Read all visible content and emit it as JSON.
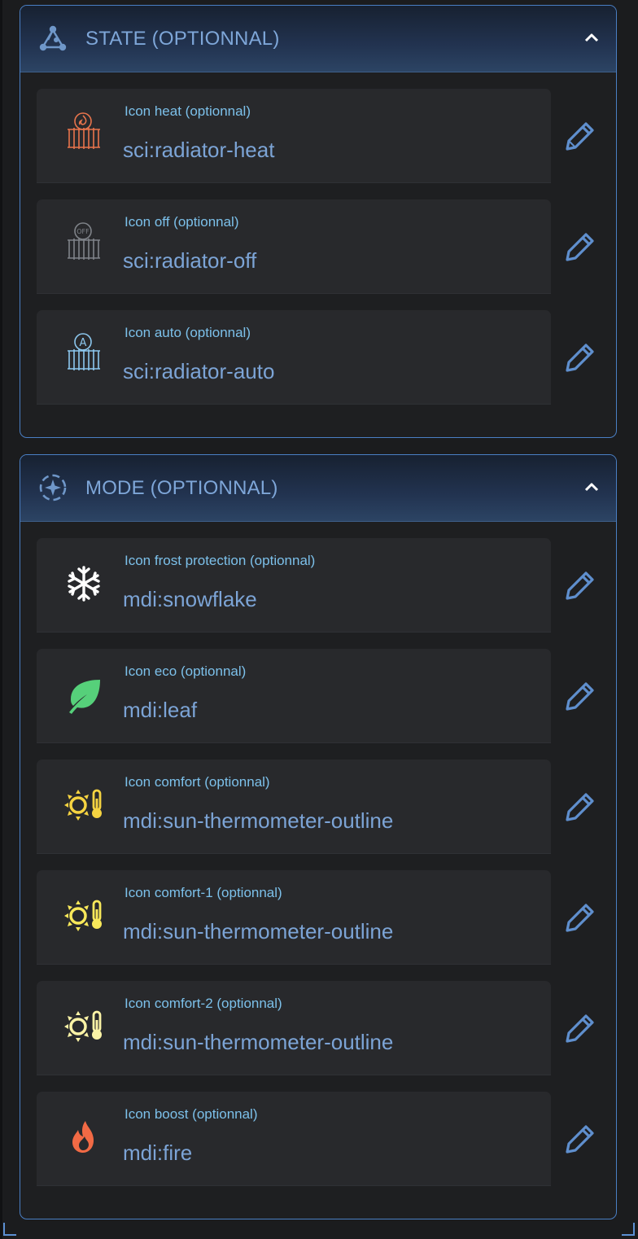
{
  "colors": {
    "accent": "#4a7fc4",
    "label": "#7cc0ea",
    "value": "#7ca4d6",
    "field_bg": "#28292c",
    "panel_bg": "#1e1f21"
  },
  "sections": [
    {
      "title": "STATE (OPTIONNAL)",
      "icon": "state-graph-icon",
      "collapse_icon": "chevron-up-icon",
      "fields": [
        {
          "label": "Icon heat (optionnal)",
          "value": "sci:radiator-heat",
          "icon": "radiator-heat-icon",
          "edit_icon": "pencil-icon"
        },
        {
          "label": "Icon off (optionnal)",
          "value": "sci:radiator-off",
          "icon": "radiator-off-icon",
          "edit_icon": "pencil-icon"
        },
        {
          "label": "Icon auto (optionnal)",
          "value": "sci:radiator-auto",
          "icon": "radiator-auto-icon",
          "edit_icon": "pencil-icon"
        }
      ]
    },
    {
      "title": "MODE (OPTIONNAL)",
      "icon": "mode-sparkle-icon",
      "collapse_icon": "chevron-up-icon",
      "fields": [
        {
          "label": "Icon frost protection (optionnal)",
          "value": "mdi:snowflake",
          "icon": "snowflake-icon",
          "edit_icon": "pencil-icon"
        },
        {
          "label": "Icon eco (optionnal)",
          "value": "mdi:leaf",
          "icon": "leaf-icon",
          "edit_icon": "pencil-icon"
        },
        {
          "label": "Icon comfort (optionnal)",
          "value": "mdi:sun-thermometer-outline",
          "icon": "sun-thermometer-icon",
          "edit_icon": "pencil-icon"
        },
        {
          "label": "Icon comfort-1 (optionnal)",
          "value": "mdi:sun-thermometer-outline",
          "icon": "sun-thermometer-icon",
          "edit_icon": "pencil-icon"
        },
        {
          "label": "Icon comfort-2 (optionnal)",
          "value": "mdi:sun-thermometer-outline",
          "icon": "sun-thermometer-icon",
          "edit_icon": "pencil-icon"
        },
        {
          "label": "Icon boost (optionnal)",
          "value": "mdi:fire",
          "icon": "fire-icon",
          "edit_icon": "pencil-icon"
        }
      ]
    }
  ]
}
